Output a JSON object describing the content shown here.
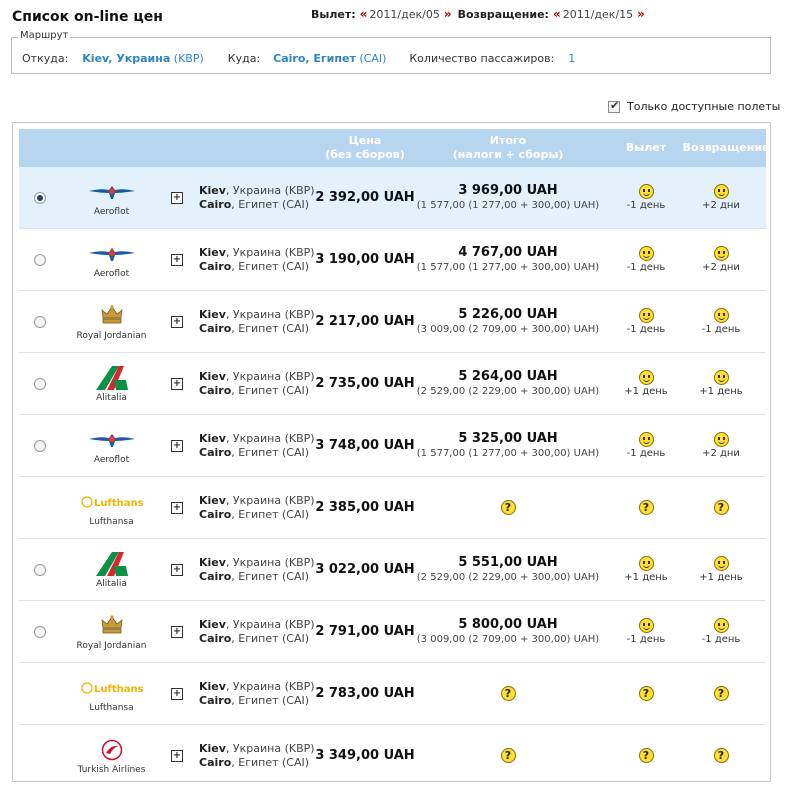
{
  "page": {
    "title": "Список on-line цен",
    "departure_label": "Вылет:",
    "departure_date": "2011/дек/05",
    "return_label": "Возвращение:",
    "return_date": "2011/дек/15",
    "prev_glyph": "«",
    "next_glyph": "»"
  },
  "route": {
    "legend": "Маршрут",
    "from_label": "Откуда:",
    "from_city": "Kiev, Украина",
    "from_code": "(KBP)",
    "to_label": "Куда:",
    "to_city": "Cairo, Египет",
    "to_code": "(CAI)",
    "passengers_label": "Количество пассажиров:",
    "passengers_value": "1"
  },
  "filter": {
    "available_only_label": "Только доступные полеты",
    "available_only_checked": true
  },
  "table": {
    "headers": {
      "price_line1": "Цена",
      "price_line2": "(без сборов)",
      "total_line1": "Итого",
      "total_line2": "(налоги + сборы)",
      "departure": "Вылет",
      "return": "Возвращение"
    },
    "accent_color": "#b8d5ef",
    "link_color": "#2e86c1",
    "expand_glyph": "+",
    "unknown_glyph": "?",
    "rows": [
      {
        "selectable": true,
        "selected": true,
        "airline": "Aeroflot",
        "logo": "aeroflot-logo",
        "from_city": "Kiev",
        "from_rest": ", Украина (KBP)",
        "to_city": "Cairo",
        "to_rest": ", Египет (CAI)",
        "price": "2 392,00 UAH",
        "total": "3 969,00 UAH",
        "breakdown": "(1 577,00 (1 277,00 + 300,00) UAH)",
        "dep": "-1 день",
        "ret": "+2 дни"
      },
      {
        "selectable": true,
        "selected": false,
        "airline": "Aeroflot",
        "logo": "aeroflot-logo",
        "from_city": "Kiev",
        "from_rest": ", Украина (KBP)",
        "to_city": "Cairo",
        "to_rest": ", Египет (CAI)",
        "price": "3 190,00 UAH",
        "total": "4 767,00 UAH",
        "breakdown": "(1 577,00 (1 277,00 + 300,00) UAH)",
        "dep": "-1 день",
        "ret": "+2 дни"
      },
      {
        "selectable": true,
        "selected": false,
        "airline": "Royal Jordanian",
        "logo": "royal-jordanian-logo",
        "from_city": "Kiev",
        "from_rest": ", Украина (KBP)",
        "to_city": "Cairo",
        "to_rest": ", Египет (CAI)",
        "price": "2 217,00 UAH",
        "total": "5 226,00 UAH",
        "breakdown": "(3 009,00 (2 709,00 + 300,00) UAH)",
        "dep": "-1 день",
        "ret": "-1 день"
      },
      {
        "selectable": true,
        "selected": false,
        "airline": "Alitalia",
        "logo": "alitalia-logo",
        "from_city": "Kiev",
        "from_rest": ", Украина (KBP)",
        "to_city": "Cairo",
        "to_rest": ", Египет (CAI)",
        "price": "2 735,00 UAH",
        "total": "5 264,00 UAH",
        "breakdown": "(2 529,00 (2 229,00 + 300,00) UAH)",
        "dep": "+1 день",
        "ret": "+1 день"
      },
      {
        "selectable": true,
        "selected": false,
        "airline": "Aeroflot",
        "logo": "aeroflot-logo",
        "from_city": "Kiev",
        "from_rest": ", Украина (KBP)",
        "to_city": "Cairo",
        "to_rest": ", Египет (CAI)",
        "price": "3 748,00 UAH",
        "total": "5 325,00 UAH",
        "breakdown": "(1 577,00 (1 277,00 + 300,00) UAH)",
        "dep": "-1 день",
        "ret": "+2 дни"
      },
      {
        "selectable": false,
        "selected": false,
        "airline": "Lufthansa",
        "logo": "lufthansa-logo",
        "from_city": "Kiev",
        "from_rest": ", Украина (KBP)",
        "to_city": "Cairo",
        "to_rest": ", Египет (CAI)",
        "price": "2 385,00 UAH",
        "total": null,
        "breakdown": null,
        "dep": null,
        "ret": null
      },
      {
        "selectable": true,
        "selected": false,
        "airline": "Alitalia",
        "logo": "alitalia-logo",
        "from_city": "Kiev",
        "from_rest": ", Украина (KBP)",
        "to_city": "Cairo",
        "to_rest": ", Египет (CAI)",
        "price": "3 022,00 UAH",
        "total": "5 551,00 UAH",
        "breakdown": "(2 529,00 (2 229,00 + 300,00) UAH)",
        "dep": "+1 день",
        "ret": "+1 день"
      },
      {
        "selectable": true,
        "selected": false,
        "airline": "Royal Jordanian",
        "logo": "royal-jordanian-logo",
        "from_city": "Kiev",
        "from_rest": ", Украина (KBP)",
        "to_city": "Cairo",
        "to_rest": ", Египет (CAI)",
        "price": "2 791,00 UAH",
        "total": "5 800,00 UAH",
        "breakdown": "(3 009,00 (2 709,00 + 300,00) UAH)",
        "dep": "-1 день",
        "ret": "-1 день"
      },
      {
        "selectable": false,
        "selected": false,
        "airline": "Lufthansa",
        "logo": "lufthansa-logo",
        "from_city": "Kiev",
        "from_rest": ", Украина (KBP)",
        "to_city": "Cairo",
        "to_rest": ", Египет (CAI)",
        "price": "2 783,00 UAH",
        "total": null,
        "breakdown": null,
        "dep": null,
        "ret": null
      },
      {
        "selectable": false,
        "selected": false,
        "airline": "Turkish Airlines",
        "logo": "turkish-airlines-logo",
        "from_city": "Kiev",
        "from_rest": ", Украина (KBP)",
        "to_city": "Cairo",
        "to_rest": ", Египет (CAI)",
        "price": "3 349,00 UAH",
        "total": null,
        "breakdown": null,
        "dep": null,
        "ret": null
      }
    ]
  }
}
